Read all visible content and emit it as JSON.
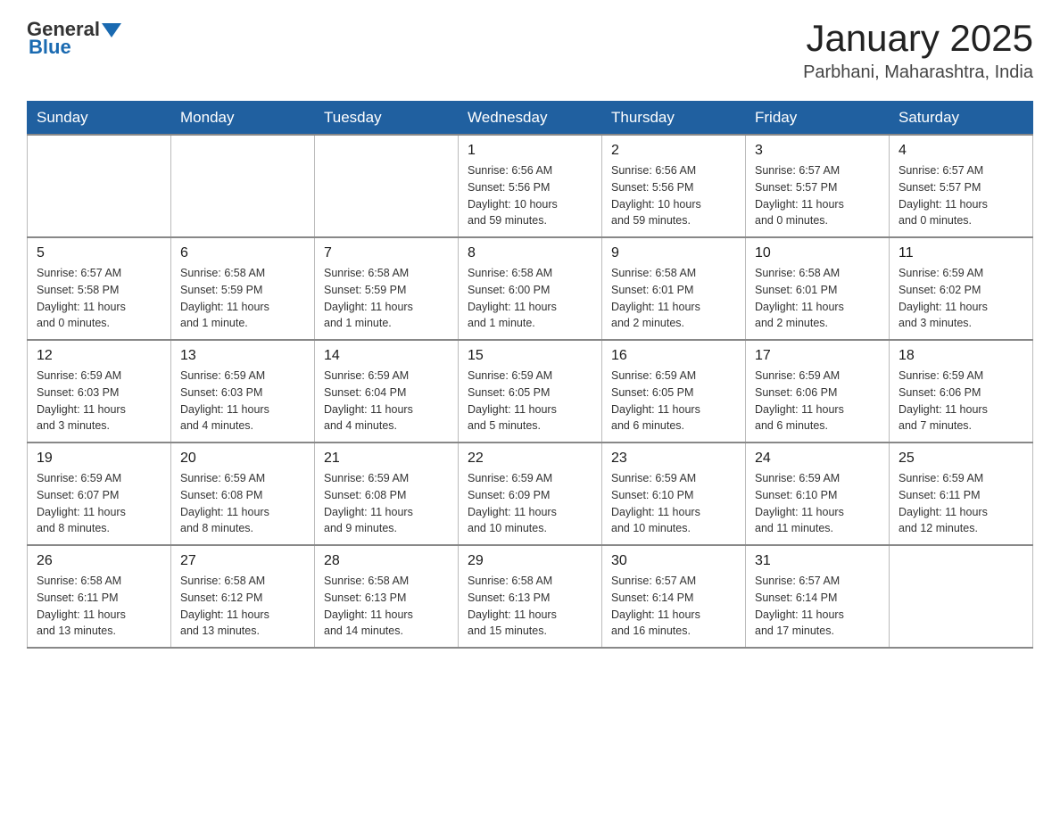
{
  "header": {
    "logo_general": "General",
    "logo_blue": "Blue",
    "title": "January 2025",
    "subtitle": "Parbhani, Maharashtra, India"
  },
  "days_of_week": [
    "Sunday",
    "Monday",
    "Tuesday",
    "Wednesday",
    "Thursday",
    "Friday",
    "Saturday"
  ],
  "weeks": [
    [
      {
        "day": "",
        "info": ""
      },
      {
        "day": "",
        "info": ""
      },
      {
        "day": "",
        "info": ""
      },
      {
        "day": "1",
        "info": "Sunrise: 6:56 AM\nSunset: 5:56 PM\nDaylight: 10 hours\nand 59 minutes."
      },
      {
        "day": "2",
        "info": "Sunrise: 6:56 AM\nSunset: 5:56 PM\nDaylight: 10 hours\nand 59 minutes."
      },
      {
        "day": "3",
        "info": "Sunrise: 6:57 AM\nSunset: 5:57 PM\nDaylight: 11 hours\nand 0 minutes."
      },
      {
        "day": "4",
        "info": "Sunrise: 6:57 AM\nSunset: 5:57 PM\nDaylight: 11 hours\nand 0 minutes."
      }
    ],
    [
      {
        "day": "5",
        "info": "Sunrise: 6:57 AM\nSunset: 5:58 PM\nDaylight: 11 hours\nand 0 minutes."
      },
      {
        "day": "6",
        "info": "Sunrise: 6:58 AM\nSunset: 5:59 PM\nDaylight: 11 hours\nand 1 minute."
      },
      {
        "day": "7",
        "info": "Sunrise: 6:58 AM\nSunset: 5:59 PM\nDaylight: 11 hours\nand 1 minute."
      },
      {
        "day": "8",
        "info": "Sunrise: 6:58 AM\nSunset: 6:00 PM\nDaylight: 11 hours\nand 1 minute."
      },
      {
        "day": "9",
        "info": "Sunrise: 6:58 AM\nSunset: 6:01 PM\nDaylight: 11 hours\nand 2 minutes."
      },
      {
        "day": "10",
        "info": "Sunrise: 6:58 AM\nSunset: 6:01 PM\nDaylight: 11 hours\nand 2 minutes."
      },
      {
        "day": "11",
        "info": "Sunrise: 6:59 AM\nSunset: 6:02 PM\nDaylight: 11 hours\nand 3 minutes."
      }
    ],
    [
      {
        "day": "12",
        "info": "Sunrise: 6:59 AM\nSunset: 6:03 PM\nDaylight: 11 hours\nand 3 minutes."
      },
      {
        "day": "13",
        "info": "Sunrise: 6:59 AM\nSunset: 6:03 PM\nDaylight: 11 hours\nand 4 minutes."
      },
      {
        "day": "14",
        "info": "Sunrise: 6:59 AM\nSunset: 6:04 PM\nDaylight: 11 hours\nand 4 minutes."
      },
      {
        "day": "15",
        "info": "Sunrise: 6:59 AM\nSunset: 6:05 PM\nDaylight: 11 hours\nand 5 minutes."
      },
      {
        "day": "16",
        "info": "Sunrise: 6:59 AM\nSunset: 6:05 PM\nDaylight: 11 hours\nand 6 minutes."
      },
      {
        "day": "17",
        "info": "Sunrise: 6:59 AM\nSunset: 6:06 PM\nDaylight: 11 hours\nand 6 minutes."
      },
      {
        "day": "18",
        "info": "Sunrise: 6:59 AM\nSunset: 6:06 PM\nDaylight: 11 hours\nand 7 minutes."
      }
    ],
    [
      {
        "day": "19",
        "info": "Sunrise: 6:59 AM\nSunset: 6:07 PM\nDaylight: 11 hours\nand 8 minutes."
      },
      {
        "day": "20",
        "info": "Sunrise: 6:59 AM\nSunset: 6:08 PM\nDaylight: 11 hours\nand 8 minutes."
      },
      {
        "day": "21",
        "info": "Sunrise: 6:59 AM\nSunset: 6:08 PM\nDaylight: 11 hours\nand 9 minutes."
      },
      {
        "day": "22",
        "info": "Sunrise: 6:59 AM\nSunset: 6:09 PM\nDaylight: 11 hours\nand 10 minutes."
      },
      {
        "day": "23",
        "info": "Sunrise: 6:59 AM\nSunset: 6:10 PM\nDaylight: 11 hours\nand 10 minutes."
      },
      {
        "day": "24",
        "info": "Sunrise: 6:59 AM\nSunset: 6:10 PM\nDaylight: 11 hours\nand 11 minutes."
      },
      {
        "day": "25",
        "info": "Sunrise: 6:59 AM\nSunset: 6:11 PM\nDaylight: 11 hours\nand 12 minutes."
      }
    ],
    [
      {
        "day": "26",
        "info": "Sunrise: 6:58 AM\nSunset: 6:11 PM\nDaylight: 11 hours\nand 13 minutes."
      },
      {
        "day": "27",
        "info": "Sunrise: 6:58 AM\nSunset: 6:12 PM\nDaylight: 11 hours\nand 13 minutes."
      },
      {
        "day": "28",
        "info": "Sunrise: 6:58 AM\nSunset: 6:13 PM\nDaylight: 11 hours\nand 14 minutes."
      },
      {
        "day": "29",
        "info": "Sunrise: 6:58 AM\nSunset: 6:13 PM\nDaylight: 11 hours\nand 15 minutes."
      },
      {
        "day": "30",
        "info": "Sunrise: 6:57 AM\nSunset: 6:14 PM\nDaylight: 11 hours\nand 16 minutes."
      },
      {
        "day": "31",
        "info": "Sunrise: 6:57 AM\nSunset: 6:14 PM\nDaylight: 11 hours\nand 17 minutes."
      },
      {
        "day": "",
        "info": ""
      }
    ]
  ]
}
